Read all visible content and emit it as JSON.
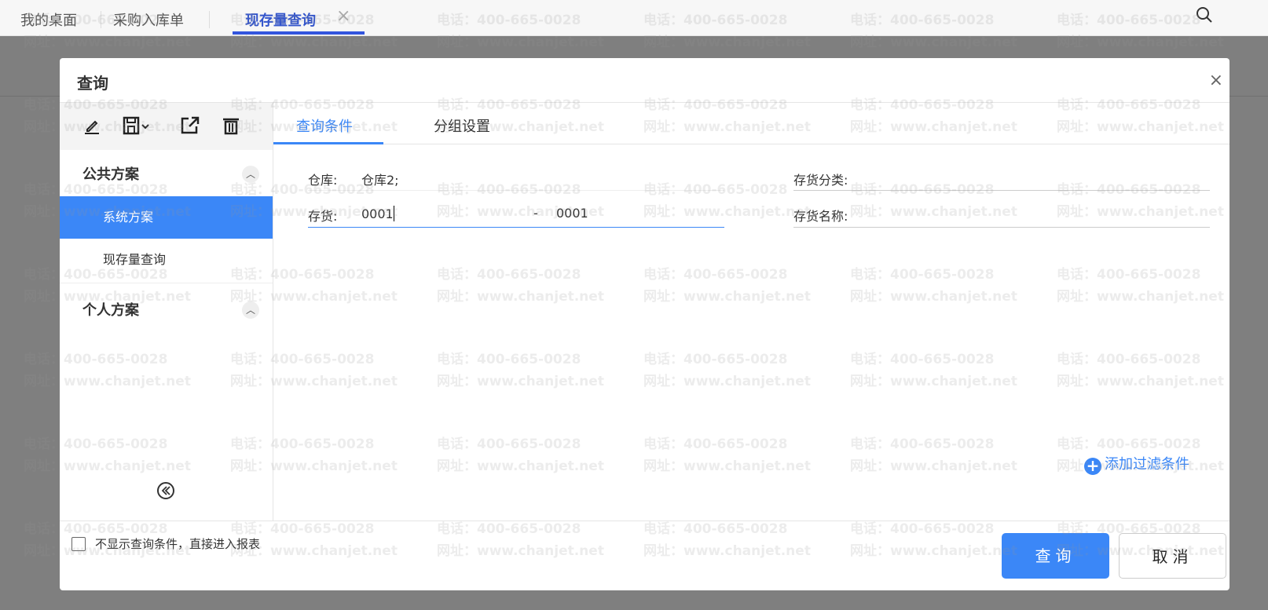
{
  "tabs": [
    {
      "label": "我的桌面"
    },
    {
      "label": "采购入库单"
    },
    {
      "label": "现存量查询",
      "close": "×"
    }
  ],
  "dialog": {
    "title": "查询",
    "close": "×",
    "toolbar": [
      "edit-icon",
      "save-icon",
      "export-icon",
      "delete-icon"
    ],
    "groups": [
      {
        "label": "公共方案",
        "items": [
          "系统方案",
          "现存量查询"
        ]
      },
      {
        "label": "个人方案",
        "items": []
      }
    ],
    "tabs": [
      "查询条件",
      "分组设置"
    ],
    "fields": {
      "warehouse_label": "仓库:",
      "warehouse_value": "仓库2;",
      "inventory_label": "存货:",
      "inventory_from": "0001",
      "range_sep": "-",
      "inventory_to": "0001",
      "category_label": "存货分类:",
      "name_label": "存货名称:"
    },
    "add_filter": "添加过滤条件",
    "skip_label": "不显示查询条件，直接进入报表",
    "query_button": "查询",
    "cancel_button": "取消"
  },
  "watermark": {
    "phone": "电话：400-665-0028",
    "site": "网址：www.chanjet.net"
  },
  "colors": {
    "accent": "#3b87f7",
    "tab_active": "#3355dd"
  }
}
